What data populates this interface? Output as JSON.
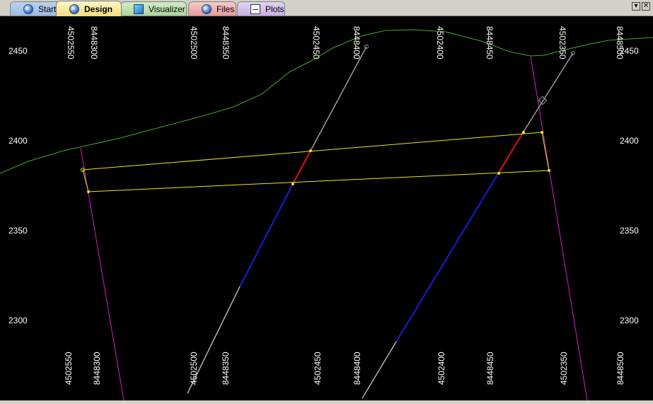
{
  "tabs": [
    {
      "label": "Start",
      "icon": "globe-icon"
    },
    {
      "label": "Design",
      "icon": "globe-icon",
      "active": true
    },
    {
      "label": "Visualizer",
      "icon": "cube-icon"
    },
    {
      "label": "Files",
      "icon": "globe-icon"
    },
    {
      "label": "Plots",
      "icon": "plot-icon"
    }
  ],
  "window_controls": {
    "menu": "▾",
    "close": "✕"
  },
  "section_view": {
    "elevation_labels": [
      "2450",
      "2400",
      "2350",
      "2300"
    ],
    "top_axis_labels": [
      "4502550",
      "8448300",
      "4502500",
      "8448350",
      "4502450",
      "8448400",
      "4502400",
      "8448450",
      "4502350",
      "8448500"
    ],
    "bottom_axis_labels": [
      "4502550",
      "8448300",
      "4502500",
      "8448350",
      "4502450",
      "8448400",
      "4502400",
      "8448450",
      "4502350",
      "8448500"
    ],
    "colors": {
      "background": "#000000",
      "topography": "#3faa1f",
      "stope_outline": "#e6e61a",
      "boundary": "#d21ed2",
      "hole_collar_segment": "#9a9a9a",
      "hole_ore_intercept": "#e01010",
      "hole_waste_segment": "#1a1adc",
      "axis_text": "#ffffff"
    }
  }
}
